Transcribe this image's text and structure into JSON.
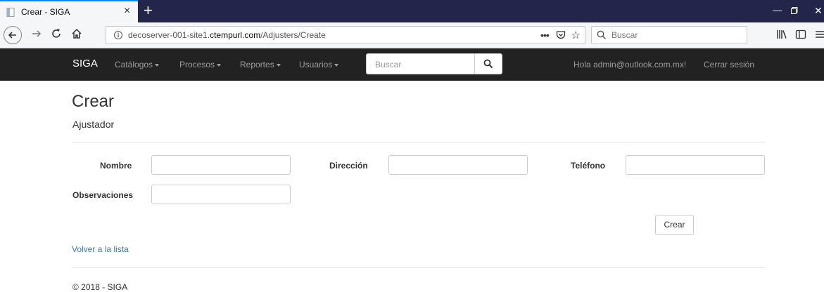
{
  "browser": {
    "tab_title": "Crear - SIGA",
    "url_prefix": "decoserver-001-site1.",
    "url_domain": "ctempurl.com",
    "url_path": "/Adjusters/Create",
    "search_placeholder": "Buscar",
    "accent_color": "#0a84ff",
    "tabstrip_color": "#23254a"
  },
  "navbar": {
    "brand": "SIGA",
    "menus": [
      {
        "label": "Catálogos"
      },
      {
        "label": "Procesos"
      },
      {
        "label": "Reportes"
      },
      {
        "label": "Usuarios"
      }
    ],
    "search_placeholder": "Buscar",
    "greeting": "Hola admin@outlook.com.mx!",
    "logout": "Cerrar sesión",
    "background": "#222222"
  },
  "page": {
    "title": "Crear",
    "subtitle": "Ajustador",
    "fields": [
      {
        "label": "Nombre",
        "value": ""
      },
      {
        "label": "Dirección",
        "value": ""
      },
      {
        "label": "Teléfono",
        "value": ""
      },
      {
        "label": "Observaciones",
        "value": ""
      }
    ],
    "submit_label": "Crear",
    "back_link": "Volver a la lista",
    "link_color": "#337ab7"
  },
  "footer": {
    "text": "© 2018 - SIGA"
  }
}
